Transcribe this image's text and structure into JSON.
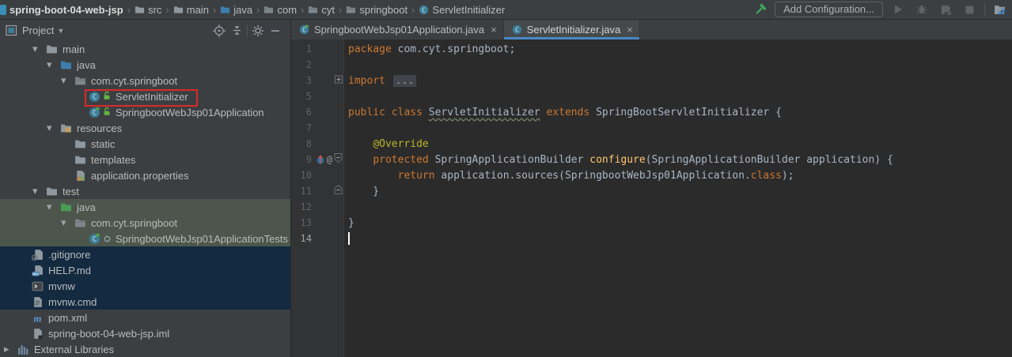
{
  "colors": {
    "keyword": "#cc7832",
    "annotation": "#bbb529",
    "method": "#ffc66d",
    "plain_code": "#a9b7c6",
    "selection_navy": "#132a40",
    "selection_green": "#4d564c",
    "active_tab_underline": "#4a88c7",
    "annotation_box_red": "#d92b2b",
    "editor_bg": "#2b2b2b",
    "panel_bg": "#3c3f41"
  },
  "top_bar": {
    "project_name": "spring-boot-04-web-jsp",
    "breadcrumbs": [
      {
        "label": "src",
        "icon": "folder"
      },
      {
        "label": "main",
        "icon": "folder"
      },
      {
        "label": "java",
        "icon": "folder-source"
      },
      {
        "label": "com",
        "icon": "package"
      },
      {
        "label": "cyt",
        "icon": "package"
      },
      {
        "label": "springboot",
        "icon": "package"
      },
      {
        "label": "ServletInitializer",
        "icon": "class"
      }
    ],
    "toolbar": {
      "add_configuration_label": "Add Configuration...",
      "icons": [
        "build-hammer",
        "run",
        "debug",
        "coverage",
        "stop",
        "project-structure"
      ]
    }
  },
  "project_panel": {
    "header": {
      "title": "Project",
      "icons": [
        "tool-window",
        "locate",
        "collapse-all",
        "settings-gear",
        "hide-panel"
      ]
    },
    "tree": [
      {
        "label": "main",
        "icon": "folder",
        "depth": 3,
        "arrow": "expanded",
        "selected": "none"
      },
      {
        "label": "java",
        "icon": "folder-source",
        "depth": 4,
        "arrow": "expanded",
        "selected": "none"
      },
      {
        "label": "com.cyt.springboot",
        "icon": "package",
        "depth": 5,
        "arrow": "expanded",
        "selected": "none"
      },
      {
        "label": "ServletInitializer",
        "icon": "class",
        "lock": true,
        "depth": 6,
        "arrow": null,
        "selected": "none",
        "red_box": true
      },
      {
        "label": "SpringbootWebJsp01Application",
        "icon": "class-run",
        "lock": true,
        "depth": 6,
        "arrow": null,
        "selected": "none"
      },
      {
        "label": "resources",
        "icon": "folder-resources",
        "depth": 4,
        "arrow": "expanded",
        "selected": "none"
      },
      {
        "label": "static",
        "icon": "folder",
        "depth": 5,
        "arrow": null,
        "selected": "none"
      },
      {
        "label": "templates",
        "icon": "folder",
        "depth": 5,
        "arrow": null,
        "selected": "none"
      },
      {
        "label": "application.properties",
        "icon": "file-properties",
        "depth": 5,
        "arrow": null,
        "selected": "none"
      },
      {
        "label": "test",
        "icon": "folder",
        "depth": 3,
        "arrow": "expanded",
        "selected": "none"
      },
      {
        "label": "java",
        "icon": "folder-test",
        "depth": 4,
        "arrow": "expanded",
        "selected": "green"
      },
      {
        "label": "com.cyt.springboot",
        "icon": "package",
        "depth": 5,
        "arrow": "expanded",
        "selected": "green"
      },
      {
        "label": "SpringbootWebJsp01ApplicationTests",
        "icon": "class-run",
        "bullet": true,
        "depth": 6,
        "arrow": null,
        "selected": "green"
      },
      {
        "label": ".gitignore",
        "icon": "file-ignored",
        "depth": 2,
        "arrow": null,
        "selected": "navy"
      },
      {
        "label": "HELP.md",
        "icon": "file-md",
        "depth": 2,
        "arrow": null,
        "selected": "navy"
      },
      {
        "label": "mvnw",
        "icon": "file-shell",
        "depth": 2,
        "arrow": null,
        "selected": "navy"
      },
      {
        "label": "mvnw.cmd",
        "icon": "file-text",
        "depth": 2,
        "arrow": null,
        "selected": "navy"
      },
      {
        "label": "pom.xml",
        "icon": "maven",
        "depth": 2,
        "arrow": null,
        "selected": "none"
      },
      {
        "label": "spring-boot-04-web-jsp.iml",
        "icon": "file-iml",
        "depth": 2,
        "arrow": null,
        "selected": "none"
      },
      {
        "label": "External Libraries",
        "icon": "external-libraries",
        "depth": 1,
        "arrow": "collapsed",
        "selected": "none"
      }
    ]
  },
  "editor": {
    "tabs": [
      {
        "label": "SpringbootWebJsp01Application.java",
        "icon": "class-run",
        "active": false
      },
      {
        "label": "ServletInitializer.java",
        "icon": "class",
        "active": true
      }
    ],
    "code": {
      "caret_line": "14",
      "lines": [
        {
          "n": "1",
          "segs": [
            {
              "t": "package ",
              "c": "kw"
            },
            {
              "t": "com.cyt.springboot;",
              "c": "pl"
            }
          ]
        },
        {
          "n": "2",
          "segs": []
        },
        {
          "n": "3",
          "fold": "plus",
          "segs": [
            {
              "t": "import ",
              "c": "kw"
            },
            {
              "t": "...",
              "c": "fold"
            }
          ]
        },
        {
          "n": "5",
          "segs": []
        },
        {
          "n": "6",
          "segs": [
            {
              "t": "public class ",
              "c": "kw"
            },
            {
              "t": "ServletInitializer",
              "c": "decl"
            },
            {
              "t": " extends ",
              "c": "kw"
            },
            {
              "t": "SpringBootServletInitializer {",
              "c": "pl"
            }
          ]
        },
        {
          "n": "7",
          "segs": []
        },
        {
          "n": "8",
          "segs": [
            {
              "t": "    ",
              "c": "pl"
            },
            {
              "t": "@Override",
              "c": "ann"
            }
          ]
        },
        {
          "n": "9",
          "gutter": [
            "override",
            "annotation-at"
          ],
          "fold": "minus-down",
          "segs": [
            {
              "t": "    ",
              "c": "pl"
            },
            {
              "t": "protected ",
              "c": "kw"
            },
            {
              "t": "SpringApplicationBuilder ",
              "c": "pl"
            },
            {
              "t": "configure",
              "c": "method"
            },
            {
              "t": "(SpringApplicationBuilder application) {",
              "c": "pl"
            }
          ]
        },
        {
          "n": "10",
          "segs": [
            {
              "t": "        ",
              "c": "pl"
            },
            {
              "t": "return ",
              "c": "kw"
            },
            {
              "t": "application.sources(SpringbootWebJsp01Application.",
              "c": "pl"
            },
            {
              "t": "class",
              "c": "kw"
            },
            {
              "t": ");",
              "c": "pl"
            }
          ]
        },
        {
          "n": "11",
          "fold": "minus-up",
          "segs": [
            {
              "t": "    }",
              "c": "pl"
            }
          ]
        },
        {
          "n": "12",
          "segs": []
        },
        {
          "n": "13",
          "segs": [
            {
              "t": "}",
              "c": "pl"
            }
          ]
        },
        {
          "n": "14",
          "caret": true,
          "segs": []
        }
      ]
    }
  }
}
